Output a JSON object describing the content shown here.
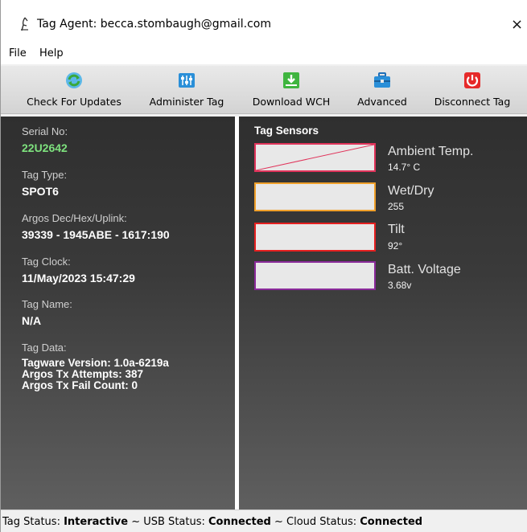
{
  "window": {
    "title": "Tag Agent: becca.stombaugh@gmail.com",
    "close_glyph": "×"
  },
  "menu": {
    "items": [
      "File",
      "Help"
    ]
  },
  "toolbar": {
    "buttons": [
      {
        "label": "Check For Updates",
        "icon": "refresh-icon"
      },
      {
        "label": "Administer Tag",
        "icon": "sliders-icon"
      },
      {
        "label": "Download WCH",
        "icon": "download-icon"
      },
      {
        "label": "Advanced",
        "icon": "toolbox-icon"
      },
      {
        "label": "Disconnect Tag",
        "icon": "power-icon"
      }
    ]
  },
  "info": {
    "serial_label": "Serial No:",
    "serial_value": "22U2642",
    "type_label": "Tag Type:",
    "type_value": "SPOT6",
    "argos_label": "Argos Dec/Hex/Uplink:",
    "argos_value": "39339 - 1945ABE - 1617:190",
    "clock_label": "Tag Clock:",
    "clock_value": "11/May/2023 15:47:29",
    "name_label": "Tag Name:",
    "name_value": "N/A",
    "data_label": "Tag Data:",
    "data_lines": [
      "Tagware Version: 1.0a-6219a",
      "Argos Tx Attempts: 387",
      "Argos Tx Fail Count: 0"
    ]
  },
  "sensors": {
    "title": "Tag Sensors",
    "items": [
      {
        "name": "Ambient Temp.",
        "value": "14.7° C",
        "color": "#e0335a"
      },
      {
        "name": "Wet/Dry",
        "value": "255",
        "color": "#f0a02a"
      },
      {
        "name": "Tilt",
        "value": "92°",
        "color": "#e62020"
      },
      {
        "name": "Batt. Voltage",
        "value": "3.68v",
        "color": "#8a2a9a"
      }
    ]
  },
  "status": {
    "tag_label": "Tag Status:",
    "tag_value": "Interactive",
    "usb_label": "~ USB Status:",
    "usb_value": "Connected",
    "cloud_label": "~ Cloud Status:",
    "cloud_value": "Connected"
  }
}
